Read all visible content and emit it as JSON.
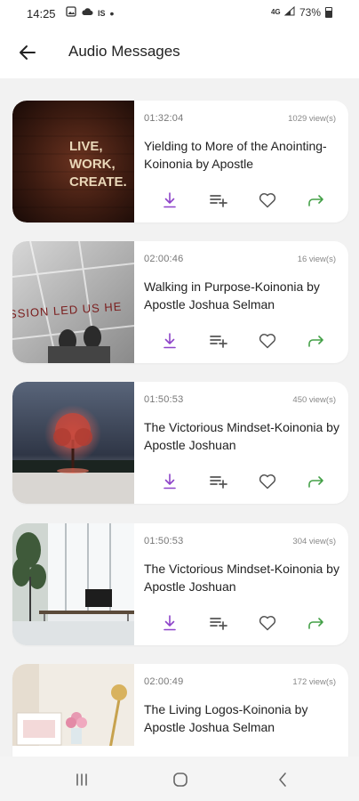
{
  "status_bar": {
    "time": "14:25",
    "left_icons": [
      "image-icon",
      "cloud-icon",
      "is-icon",
      "dot-icon"
    ],
    "is_label": "IS",
    "network": "4G",
    "battery": "73%"
  },
  "header": {
    "title": "Audio Messages",
    "back_icon": "arrow-left-icon"
  },
  "messages": [
    {
      "duration": "01:32:04",
      "views": "1029 view(s)",
      "title": "Yielding to More of the Anointing-Koinonia by Apostle",
      "thumbnail": "live-work-create-sign",
      "thumb_text": [
        "LIVE,",
        "WORK,",
        "CREATE."
      ]
    },
    {
      "duration": "02:00:46",
      "views": "16 view(s)",
      "title": "Walking in Purpose-Koinonia by Apostle Joshua Selman",
      "thumbnail": "passion-led-us-here-sidewalk",
      "thumb_text": [
        "SSION LED US HE"
      ]
    },
    {
      "duration": "01:50:53",
      "views": "450 view(s)",
      "title": "The Victorious Mindset-Koinonia by Apostle Joshuan",
      "thumbnail": "glowing-tree-night"
    },
    {
      "duration": "01:50:53",
      "views": "304 view(s)",
      "title": "The Victorious Mindset-Koinonia by Apostle Joshuan",
      "thumbnail": "office-desk-window"
    },
    {
      "duration": "02:00:49",
      "views": "172 view(s)",
      "title": "The Living Logos-Koinonia by Apostle Joshua Selman",
      "thumbnail": "desk-lamp-flowers"
    }
  ],
  "action_icons": [
    "download-icon",
    "add-to-playlist-icon",
    "heart-icon",
    "share-icon"
  ],
  "colors": {
    "download": "#8e44c9",
    "share": "#43a047",
    "icon_gray": "#555555",
    "background": "#f2f2f2",
    "card": "#ffffff"
  },
  "nav_bar": [
    "recent-apps-icon",
    "home-icon",
    "back-icon"
  ]
}
